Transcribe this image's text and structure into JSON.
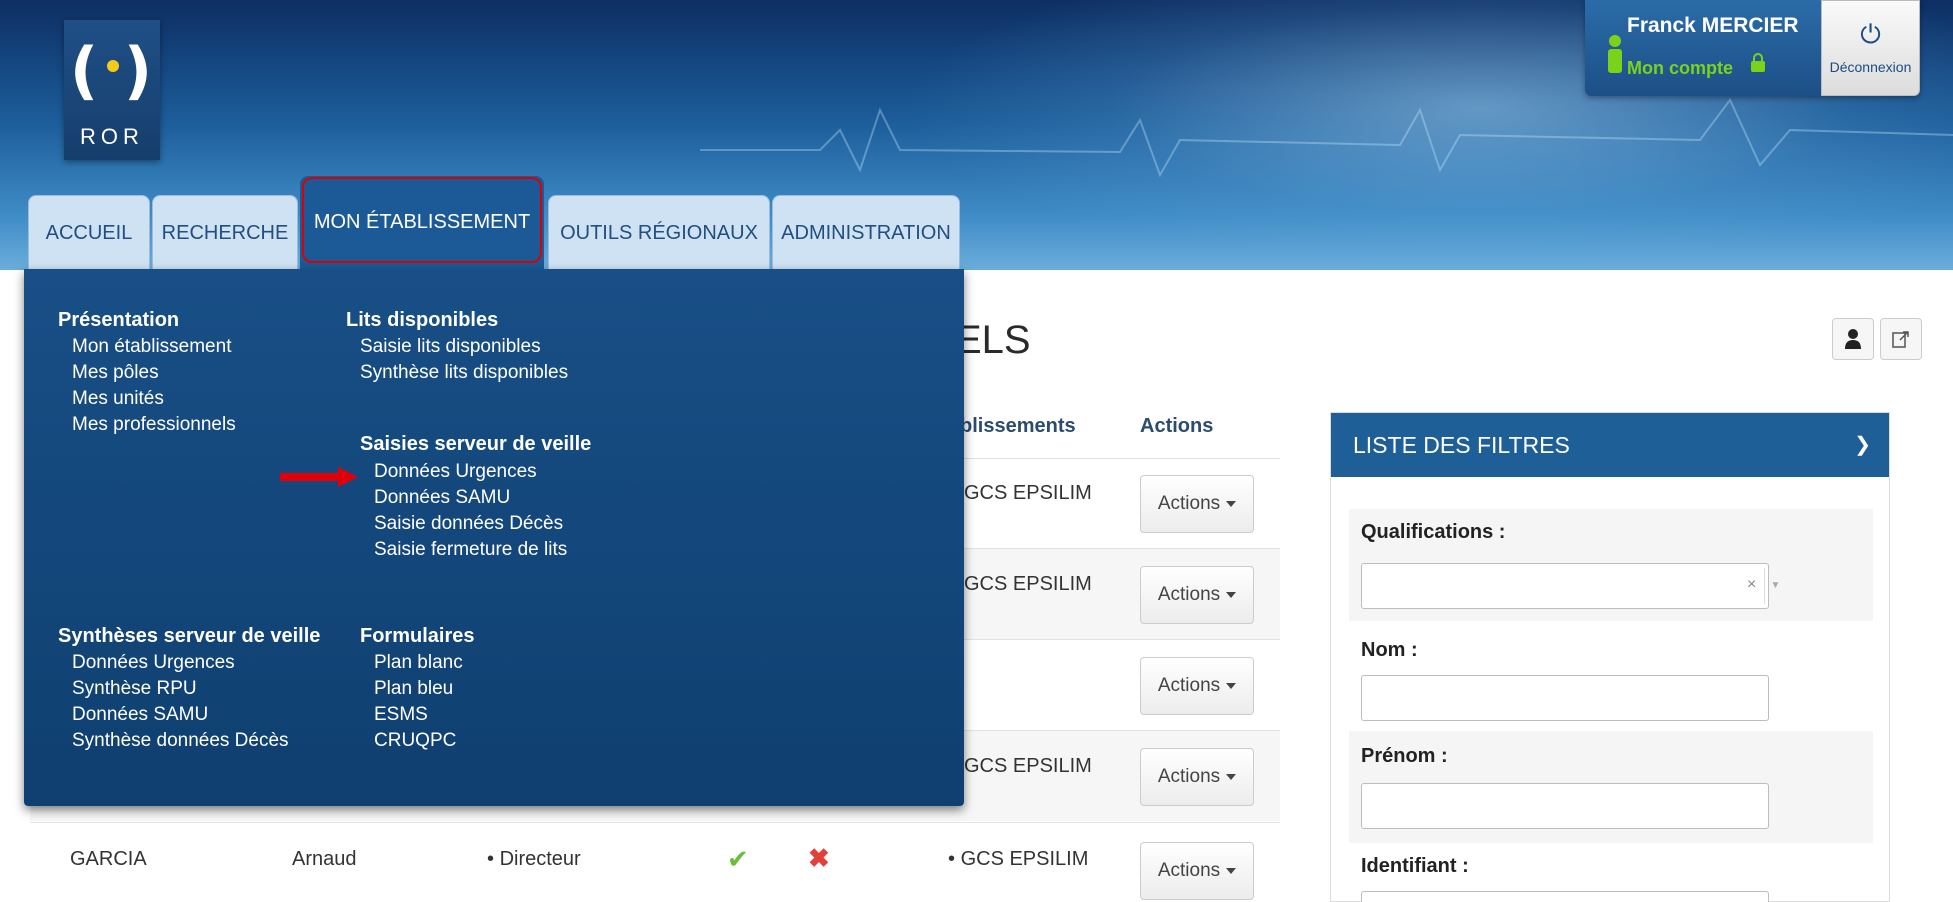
{
  "header": {
    "logo_text": "ROR",
    "user_name": "Franck MERCIER",
    "account_link": "Mon compte",
    "logout_label": "Déconnexion"
  },
  "tabs": [
    {
      "label": "ACCUEIL"
    },
    {
      "label": "RECHERCHE"
    },
    {
      "label": "MON ÉTABLISSEMENT"
    },
    {
      "label": "OUTILS RÉGIONAUX"
    },
    {
      "label": "ADMINISTRATION"
    }
  ],
  "dropdown": {
    "presentation": {
      "heading": "Présentation",
      "items": [
        "Mon établissement",
        "Mes pôles",
        "Mes unités",
        "Mes professionnels"
      ]
    },
    "lits": {
      "heading": "Lits disponibles",
      "items": [
        "Saisie lits disponibles",
        "Synthèse lits disponibles"
      ]
    },
    "saisies": {
      "heading": "Saisies serveur de veille",
      "items": [
        "Données Urgences",
        "Données SAMU",
        "Saisie données Décès",
        "Saisie fermeture de lits"
      ]
    },
    "syntheses": {
      "heading": "Synthèses serveur de veille",
      "items": [
        "Données Urgences",
        "Synthèse RPU",
        "Données SAMU",
        "Synthèse données Décès"
      ]
    },
    "formulaires": {
      "heading": "Formulaires",
      "items": [
        "Plan blanc",
        "Plan bleu",
        "ESMS",
        "CRUQPC"
      ]
    }
  },
  "main": {
    "title_fragment": "ELS",
    "col_etablissements": "blissements",
    "col_actions": "Actions",
    "actions_label": "Actions",
    "rows": [
      {
        "etab": "GCS EPSILIM"
      },
      {
        "etab": "GCS EPSILIM"
      },
      {
        "etab": ""
      },
      {
        "etab": "GCS EPSILIM"
      },
      {
        "nom": "GARCIA",
        "prenom": "Arnaud",
        "fonction": "Directeur",
        "etab": "GCS EPSILIM"
      }
    ]
  },
  "filters": {
    "title": "LISTE DES FILTRES",
    "qualifications_label": "Qualifications :",
    "nom_label": "Nom :",
    "prenom_label": "Prénom :",
    "identifiant_label": "Identifiant :"
  },
  "colors": {
    "brand_blue": "#1b5a96",
    "highlight_red": "#dd0000",
    "account_green": "#7bd21b"
  }
}
